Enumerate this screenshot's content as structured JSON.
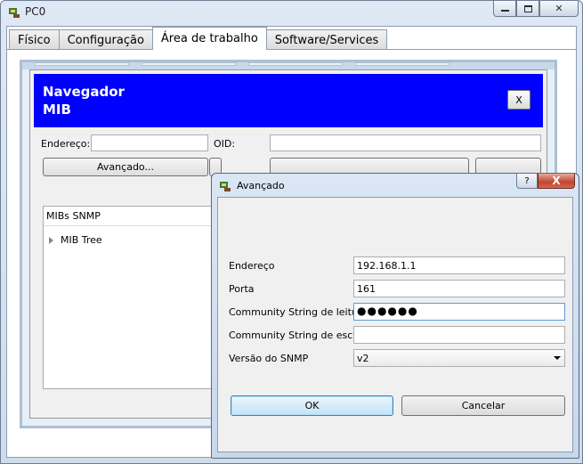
{
  "window": {
    "title": "PC0",
    "icon": "packet-tracer-pc-icon"
  },
  "tabs": [
    {
      "label": "Físico"
    },
    {
      "label": "Configuração"
    },
    {
      "label": "Área de trabalho"
    },
    {
      "label": "Software/Services"
    }
  ],
  "browser": {
    "title": "Navegador MIB",
    "close_label": "X",
    "address_label": "Endereço:",
    "address_value": "",
    "oid_label": "OID:",
    "oid_value": "",
    "advanced_button": "Avançado...",
    "tree_header": "MIBs SNMP",
    "tree_root": "MIB Tree"
  },
  "dialog": {
    "title": "Avançado",
    "help_label": "?",
    "close_label": "X",
    "fields": {
      "address_label": "Endereço",
      "address_value": "192.168.1.1",
      "port_label": "Porta",
      "port_value": "161",
      "read_label": "Community String de leitura",
      "read_value": "●●●●●●",
      "write_label": "Community String de escrita",
      "write_value": "",
      "version_label": "Versão do SNMP",
      "version_value": "v2"
    },
    "ok_label": "OK",
    "cancel_label": "Cancelar"
  }
}
